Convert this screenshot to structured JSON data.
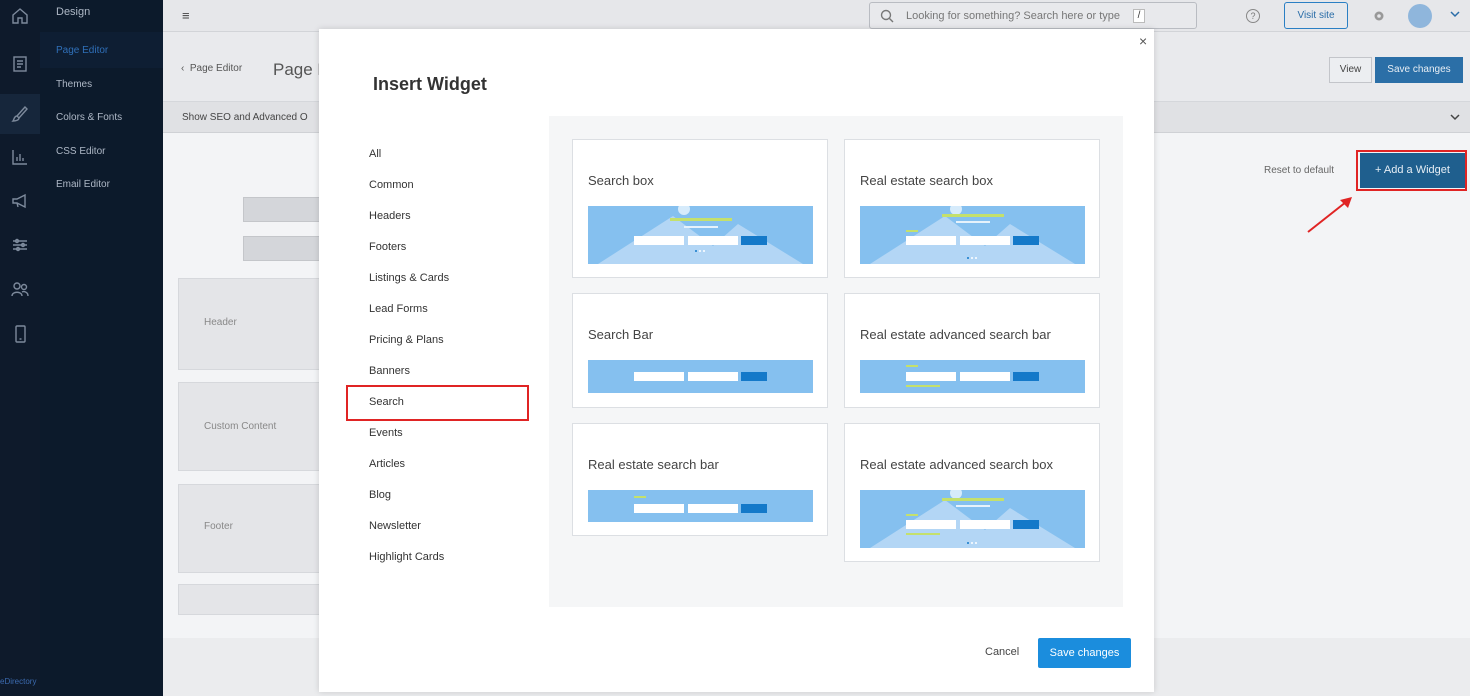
{
  "sidebar": {
    "section": "Design",
    "items": [
      "Page Editor",
      "Themes",
      "Colors & Fonts",
      "CSS Editor",
      "Email Editor"
    ],
    "active": "Page Editor",
    "footer": "eDirectory"
  },
  "topbar": {
    "search_placeholder": "Looking for something? Search here or type",
    "search_shortcut": "/",
    "help": "?",
    "visit_site": "Visit site"
  },
  "page": {
    "back": "Page Editor",
    "title": "Page E",
    "view": "View",
    "save": "Save changes",
    "seo_toggle": "Show SEO and Advanced O",
    "reset": "Reset to default",
    "add_widget": "+ Add a Widget",
    "sections": [
      "Header",
      "Custom Content",
      "Footer"
    ]
  },
  "modal": {
    "title": "Insert Widget",
    "close": "×",
    "categories": [
      "All",
      "Common",
      "Headers",
      "Footers",
      "Listings & Cards",
      "Lead Forms",
      "Pricing & Plans",
      "Banners",
      "Search",
      "Events",
      "Articles",
      "Blog",
      "Newsletter",
      "Highlight Cards"
    ],
    "selected_category": "Search",
    "widgets": [
      "Search box",
      "Real estate search box",
      "Search Bar",
      "Real estate advanced search bar",
      "Real estate search bar",
      "Real estate advanced search box"
    ],
    "cancel": "Cancel",
    "save": "Save changes"
  },
  "colors": {
    "accent": "#1b8ddd",
    "highlight": "#e02424",
    "preview_bg": "#85c0ef",
    "sidebar_bg": "#0c1a2b"
  }
}
